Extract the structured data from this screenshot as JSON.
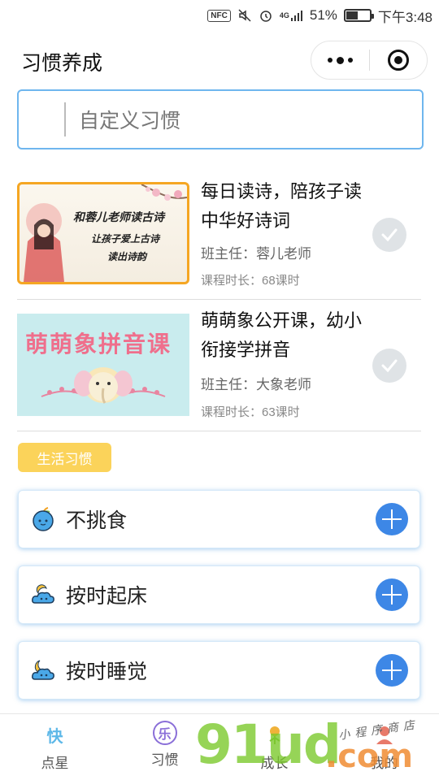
{
  "status_bar": {
    "nfc": "NFC",
    "signal": "4G",
    "battery_percent": "51%",
    "battery_level": 0.51,
    "time": "下午3:48"
  },
  "header": {
    "title": "习惯养成",
    "more_icon": "more-dots-icon",
    "close_icon": "target-circle-icon"
  },
  "custom_habit": {
    "placeholder": "自定义习惯"
  },
  "courses": [
    {
      "thumb_line1": "和蓉儿老师读古诗",
      "thumb_line2": "让孩子爱上古诗",
      "thumb_line3": "读出诗韵",
      "title": "每日读诗，陪孩子读中华好诗词",
      "teacher": "班主任：蓉儿老师",
      "duration": "课程时长：68课时"
    },
    {
      "thumb_line1": "萌萌象拼音课",
      "title": "萌萌象公开课，幼小衔接学拼音",
      "teacher": "班主任：大象老师",
      "duration": "课程时长：63课时"
    }
  ],
  "section_tag": "生活习惯",
  "habits": [
    {
      "label": "不挑食",
      "icon": "apple-icon"
    },
    {
      "label": "按时起床",
      "icon": "cloud-sun-icon"
    },
    {
      "label": "按时睡觉",
      "icon": "cloud-moon-icon"
    }
  ],
  "tabs": [
    {
      "label": "点星",
      "icon_text": "快",
      "color": "#5db8e8"
    },
    {
      "label": "习惯",
      "icon_text": "乐",
      "color": "#8a6fd8"
    },
    {
      "label": "成长",
      "icon_text": "",
      "color": "#f0b23a"
    },
    {
      "label": "我的",
      "icon_text": "",
      "color": "#e87a6a"
    }
  ],
  "watermark": {
    "text_big": "91ud",
    "text_com": ".com",
    "text_small": "小程序商店"
  },
  "colors": {
    "accent_blue": "#3d87e6",
    "input_border": "#6fb6ee",
    "tag_yellow": "#fbd35a",
    "thumb_border": "#f5a623"
  }
}
